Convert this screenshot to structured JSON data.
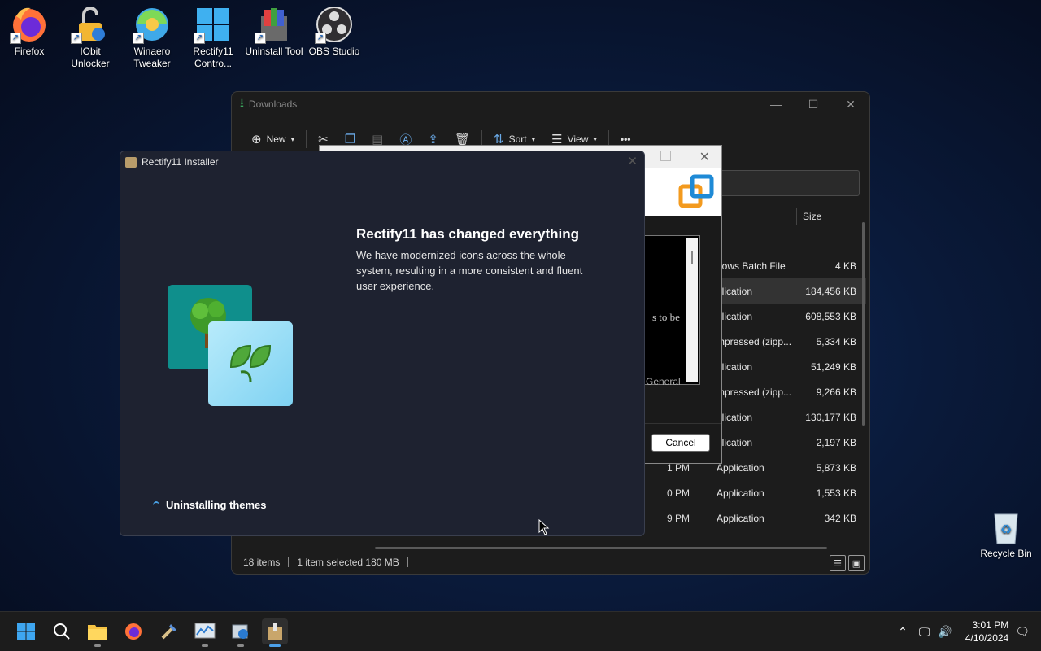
{
  "desktop": {
    "icons": [
      {
        "label": "Firefox"
      },
      {
        "label": "IObit Unlocker"
      },
      {
        "label": "Winaero Tweaker"
      },
      {
        "label": "Rectify11 Contro..."
      },
      {
        "label": "Uninstall Tool"
      },
      {
        "label": "OBS Studio"
      }
    ],
    "recycle_bin": "Recycle Bin"
  },
  "explorer": {
    "title": "Downloads",
    "toolbar": {
      "new": "New",
      "sort": "Sort",
      "view": "View",
      "more": "•••"
    },
    "columns": {
      "size": "Size"
    },
    "rows": [
      {
        "date": "",
        "type": "dows Batch File",
        "size": "4 KB",
        "selected": false
      },
      {
        "date": "",
        "type": "plication",
        "size": "184,456 KB",
        "selected": true
      },
      {
        "date": "",
        "type": "plication",
        "size": "608,553 KB",
        "selected": false
      },
      {
        "date": "",
        "type": "mpressed (zipp...",
        "size": "5,334 KB",
        "selected": false
      },
      {
        "date": "",
        "type": "plication",
        "size": "51,249 KB",
        "selected": false
      },
      {
        "date": "",
        "type": "mpressed (zipp...",
        "size": "9,266 KB",
        "selected": false
      },
      {
        "date": "",
        "type": "plication",
        "size": "130,177 KB",
        "selected": false
      },
      {
        "date": "",
        "type": "plication",
        "size": "2,197 KB",
        "selected": false
      },
      {
        "date": "1 PM",
        "type": "Application",
        "size": "5,873 KB",
        "selected": false
      },
      {
        "date": "0 PM",
        "type": "Application",
        "size": "1,553 KB",
        "selected": false
      },
      {
        "date": "9 PM",
        "type": "Application",
        "size": "342 KB",
        "selected": false
      }
    ],
    "status": {
      "items": "18 items",
      "selected": "1 item selected  180 MB"
    }
  },
  "setup_dialog": {
    "text_fragment": "s to be",
    "text_fragment2": "General",
    "cancel": "Cancel"
  },
  "installer": {
    "title": "Rectify11 Installer",
    "heading": "Rectify11 has changed everything",
    "description": "We have modernized icons across the whole system, resulting in a more consistent and fluent user experience.",
    "progress": "Uninstalling themes"
  },
  "taskbar": {
    "time": "3:01 PM",
    "date": "4/10/2024"
  }
}
